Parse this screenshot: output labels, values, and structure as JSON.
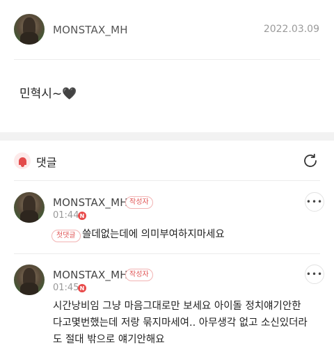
{
  "post": {
    "author": "MONSTAX_MH",
    "date": "2022.03.09",
    "body": "민혁시~🖤"
  },
  "comments_section": {
    "title": "댓글"
  },
  "comments": [
    {
      "author": "MONSTAX_MH",
      "writer_badge": "작성자",
      "time": "01:44",
      "new_badge": "N",
      "more_label": "•••",
      "tag": "첫댓글",
      "text": "쓸데없는데에 의미부여하지마세요"
    },
    {
      "author": "MONSTAX_MH",
      "writer_badge": "작성자",
      "time": "01:45",
      "new_badge": "N",
      "more_label": "•••",
      "text_lines": [
        "시간낭비임 그냥 마음그대로만 보세요 아이돌 정치얘기안한",
        "다고몇번했는데 저랑 묶지마세여.. 아무생각 없고 소신있더라",
        "도 절대 밖으로 얘기안해요"
      ]
    }
  ],
  "colors": {
    "accent_red": "#e34b4b",
    "band_gray": "#f2f2f2",
    "divider": "#ececec"
  }
}
